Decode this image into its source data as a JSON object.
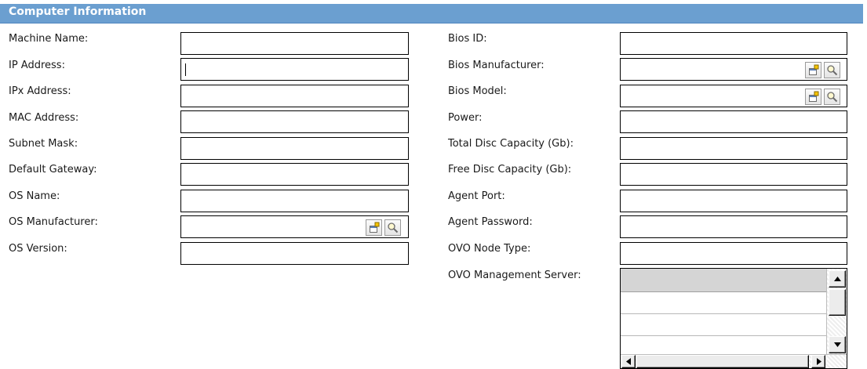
{
  "section": {
    "title": "Computer Information"
  },
  "left_fields": [
    {
      "label": "Machine Name:",
      "value": ""
    },
    {
      "label": "IP Address:",
      "value": ""
    },
    {
      "label": "IPx Address:",
      "value": ""
    },
    {
      "label": "MAC Address:",
      "value": ""
    },
    {
      "label": "Subnet Mask:",
      "value": ""
    },
    {
      "label": "Default Gateway:",
      "value": ""
    },
    {
      "label": "OS Name:",
      "value": ""
    },
    {
      "label": "OS Manufacturer:",
      "value": ""
    },
    {
      "label": "OS Version:",
      "value": ""
    }
  ],
  "right_fields": [
    {
      "label": "Bios ID:",
      "value": ""
    },
    {
      "label": "Bios Manufacturer:",
      "value": ""
    },
    {
      "label": "Bios Model:",
      "value": ""
    },
    {
      "label": "Power:",
      "value": ""
    },
    {
      "label": "Total Disc Capacity (Gb):",
      "value": ""
    },
    {
      "label": "Free Disc Capacity (Gb):",
      "value": ""
    },
    {
      "label": "Agent Port:",
      "value": ""
    },
    {
      "label": "Agent Password:",
      "value": ""
    },
    {
      "label": "OVO Node Type:",
      "value": ""
    },
    {
      "label": "OVO Management Server:",
      "value": ""
    }
  ],
  "icons": {
    "add_new": "add-new-icon",
    "lookup": "magnifier-icon",
    "scroll_up": "arrow-up-icon",
    "scroll_down": "arrow-down-icon",
    "scroll_left": "arrow-left-icon",
    "scroll_right": "arrow-right-icon"
  },
  "colors": {
    "header_bg": "#6b9fd0",
    "header_text": "#ffffff",
    "field_border": "#000000"
  }
}
